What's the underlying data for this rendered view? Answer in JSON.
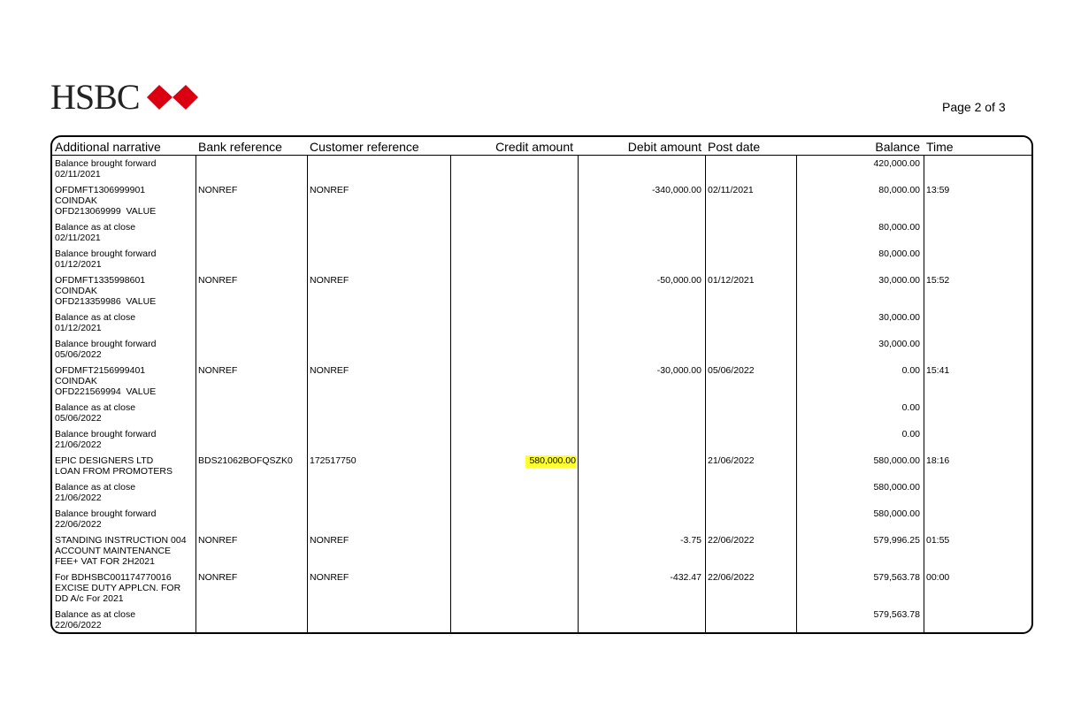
{
  "header": {
    "bank_name": "HSBC",
    "page_label": "Page 2 of  3",
    "logo_colors": {
      "red": "#db0011",
      "white": "#ffffff"
    }
  },
  "table": {
    "columns": [
      "Additional narrative",
      "Bank reference",
      "Customer reference",
      "Credit amount",
      "Debit amount",
      "Post date",
      "Balance",
      "Time"
    ],
    "rows": [
      {
        "narrative": [
          "Balance brought forward",
          "02/11/2021"
        ],
        "bank_ref": "",
        "cust_ref": "",
        "credit": "",
        "debit": "",
        "post_date": "",
        "balance": "420,000.00",
        "time": ""
      },
      {
        "narrative": [
          "OFDMFT1306999901",
          "COINDAK",
          "OFD213069999  VALUE"
        ],
        "bank_ref": "NONREF",
        "cust_ref": "NONREF",
        "credit": "",
        "debit": "-340,000.00",
        "post_date": "02/11/2021",
        "balance": "80,000.00",
        "time": "13:59"
      },
      {
        "narrative": [
          "Balance as at close",
          "02/11/2021"
        ],
        "bank_ref": "",
        "cust_ref": "",
        "credit": "",
        "debit": "",
        "post_date": "",
        "balance": "80,000.00",
        "time": ""
      },
      {
        "narrative": [
          "Balance brought forward",
          "01/12/2021"
        ],
        "bank_ref": "",
        "cust_ref": "",
        "credit": "",
        "debit": "",
        "post_date": "",
        "balance": "80,000.00",
        "time": ""
      },
      {
        "narrative": [
          "OFDMFT1335998601",
          "COINDAK",
          "OFD213359986  VALUE"
        ],
        "bank_ref": "NONREF",
        "cust_ref": "NONREF",
        "credit": "",
        "debit": "-50,000.00",
        "post_date": "01/12/2021",
        "balance": "30,000.00",
        "time": "15:52"
      },
      {
        "narrative": [
          "Balance as at close",
          "01/12/2021"
        ],
        "bank_ref": "",
        "cust_ref": "",
        "credit": "",
        "debit": "",
        "post_date": "",
        "balance": "30,000.00",
        "time": ""
      },
      {
        "narrative": [
          "Balance brought forward",
          "05/06/2022"
        ],
        "bank_ref": "",
        "cust_ref": "",
        "credit": "",
        "debit": "",
        "post_date": "",
        "balance": "30,000.00",
        "time": ""
      },
      {
        "narrative": [
          "OFDMFT2156999401",
          "COINDAK",
          "OFD221569994  VALUE"
        ],
        "bank_ref": "NONREF",
        "cust_ref": "NONREF",
        "credit": "",
        "debit": "-30,000.00",
        "post_date": "05/06/2022",
        "balance": "0.00",
        "time": "15:41"
      },
      {
        "narrative": [
          "Balance as at close",
          "05/06/2022"
        ],
        "bank_ref": "",
        "cust_ref": "",
        "credit": "",
        "debit": "",
        "post_date": "",
        "balance": "0.00",
        "time": ""
      },
      {
        "narrative": [
          "Balance brought forward",
          "21/06/2022"
        ],
        "bank_ref": "",
        "cust_ref": "",
        "credit": "",
        "debit": "",
        "post_date": "",
        "balance": "0.00",
        "time": ""
      },
      {
        "narrative": [
          "EPIC DESIGNERS LTD",
          "LOAN FROM PROMOTERS"
        ],
        "bank_ref": "BDS21062BOFQSZK0",
        "cust_ref": "172517750",
        "credit": "580,000.00",
        "credit_highlighted": true,
        "debit": "",
        "post_date": "21/06/2022",
        "balance": "580,000.00",
        "time": "18:16"
      },
      {
        "narrative": [
          "Balance as at close",
          "21/06/2022"
        ],
        "bank_ref": "",
        "cust_ref": "",
        "credit": "",
        "debit": "",
        "post_date": "",
        "balance": "580,000.00",
        "time": ""
      },
      {
        "narrative": [
          "Balance brought forward",
          "22/06/2022"
        ],
        "bank_ref": "",
        "cust_ref": "",
        "credit": "",
        "debit": "",
        "post_date": "",
        "balance": "580,000.00",
        "time": ""
      },
      {
        "narrative": [
          "STANDING INSTRUCTION 004",
          "ACCOUNT MAINTENANCE",
          "FEE+ VAT FOR 2H2021"
        ],
        "bank_ref": "NONREF",
        "cust_ref": "NONREF",
        "credit": "",
        "debit": "-3.75",
        "post_date": "22/06/2022",
        "balance": "579,996.25",
        "time": "01:55"
      },
      {
        "narrative": [
          "For BDHSBC001174770016",
          "EXCISE DUTY APPLCN. FOR",
          "DD A/c For 2021"
        ],
        "bank_ref": "NONREF",
        "cust_ref": "NONREF",
        "credit": "",
        "debit": "-432.47",
        "post_date": "22/06/2022",
        "balance": "579,563.78",
        "time": "00:00"
      },
      {
        "narrative": [
          "Balance as at close",
          "22/06/2022"
        ],
        "bank_ref": "",
        "cust_ref": "",
        "credit": "",
        "debit": "",
        "post_date": "",
        "balance": "579,563.78",
        "time": ""
      }
    ]
  },
  "highlight_color": "#ffff33"
}
